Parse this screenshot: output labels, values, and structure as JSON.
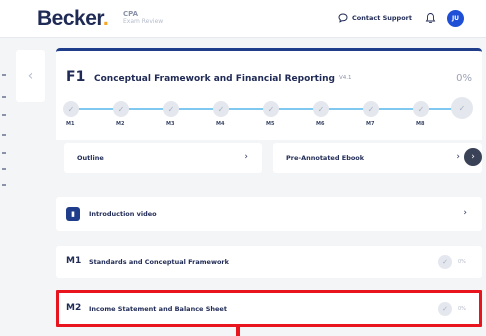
{
  "header": {
    "logo_text": "Becker",
    "logo_dot": ".",
    "subbrand_line1": "CPA",
    "subbrand_line2": "Exam Review",
    "support_label": "Contact Support",
    "avatar_initials": "JU"
  },
  "section": {
    "code": "F1",
    "title": "Conceptual Framework and Financial Reporting",
    "version": "V4.1",
    "percent": "0%",
    "milestones": [
      "M1",
      "M2",
      "M3",
      "M4",
      "M5",
      "M6",
      "M7",
      "M8"
    ]
  },
  "links": {
    "outline": "Outline",
    "ebook": "Pre-Annotated Ebook"
  },
  "intro": {
    "label": "Introduction video"
  },
  "modules": [
    {
      "code": "M1",
      "title": "Standards and Conceptual Framework",
      "percent": "0%"
    },
    {
      "code": "M2",
      "title": "Income Statement and Balance Sheet",
      "percent": "0%"
    }
  ],
  "icons": {
    "support": "chat-bubble-icon",
    "bell": "bell-icon",
    "back": "chevron-left-icon",
    "check": "check-icon",
    "chevron": "chevron-right-icon",
    "video": "video-icon"
  },
  "colors": {
    "accent": "#1f3d8a",
    "progress": "#7fc8f0",
    "highlight": "#e8141e",
    "logo_dot": "#f5a623",
    "avatar": "#1f4fd6"
  }
}
